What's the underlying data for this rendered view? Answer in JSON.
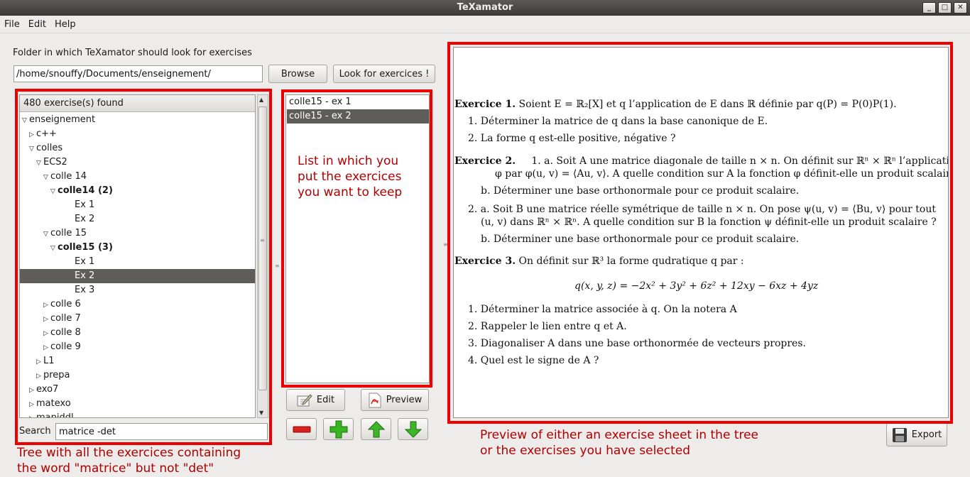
{
  "window": {
    "title": "TeXamator",
    "minimize_glyph": "_",
    "maximize_glyph": "□",
    "close_glyph": "✕"
  },
  "menu": [
    "File",
    "Edit",
    "Help"
  ],
  "folder": {
    "label": "Folder in which TeXamator should look for exercises",
    "path": "/home/snouffy/Documents/enseignement/",
    "browse_label": "Browse",
    "look_label": "Look for exercices !"
  },
  "tree": {
    "header": "480 exercise(s) found",
    "rows": [
      {
        "label": "enseignement",
        "arrow": "▽",
        "depth": 0,
        "bold": false,
        "selected": false
      },
      {
        "label": "c++",
        "arrow": "▷",
        "depth": 1,
        "bold": false,
        "selected": false
      },
      {
        "label": "colles",
        "arrow": "▽",
        "depth": 1,
        "bold": false,
        "selected": false
      },
      {
        "label": "ECS2",
        "arrow": "▽",
        "depth": 2,
        "bold": false,
        "selected": false
      },
      {
        "label": "colle 14",
        "arrow": "▽",
        "depth": 3,
        "bold": false,
        "selected": false
      },
      {
        "label": "colle14 (2)",
        "arrow": "▽",
        "depth": 4,
        "bold": true,
        "selected": false
      },
      {
        "label": "Ex 1",
        "arrow": "",
        "depth": 5,
        "bold": false,
        "selected": false
      },
      {
        "label": "Ex 2",
        "arrow": "",
        "depth": 5,
        "bold": false,
        "selected": false
      },
      {
        "label": "colle 15",
        "arrow": "▽",
        "depth": 3,
        "bold": false,
        "selected": false
      },
      {
        "label": "colle15 (3)",
        "arrow": "▽",
        "depth": 4,
        "bold": true,
        "selected": false
      },
      {
        "label": "Ex 1",
        "arrow": "",
        "depth": 5,
        "bold": false,
        "selected": false
      },
      {
        "label": "Ex 2",
        "arrow": "",
        "depth": 5,
        "bold": false,
        "selected": true
      },
      {
        "label": "Ex 3",
        "arrow": "",
        "depth": 5,
        "bold": false,
        "selected": false
      },
      {
        "label": "colle 6",
        "arrow": "▷",
        "depth": 3,
        "bold": false,
        "selected": false
      },
      {
        "label": "colle 7",
        "arrow": "▷",
        "depth": 3,
        "bold": false,
        "selected": false
      },
      {
        "label": "colle 8",
        "arrow": "▷",
        "depth": 3,
        "bold": false,
        "selected": false
      },
      {
        "label": "colle 9",
        "arrow": "▷",
        "depth": 3,
        "bold": false,
        "selected": false
      },
      {
        "label": "L1",
        "arrow": "▷",
        "depth": 2,
        "bold": false,
        "selected": false
      },
      {
        "label": "prepa",
        "arrow": "▷",
        "depth": 2,
        "bold": false,
        "selected": false
      },
      {
        "label": "exo7",
        "arrow": "▷",
        "depth": 1,
        "bold": false,
        "selected": false
      },
      {
        "label": "matexo",
        "arrow": "▷",
        "depth": 1,
        "bold": false,
        "selected": false
      },
      {
        "label": "mapiddl",
        "arrow": "▷",
        "depth": 1,
        "bold": false,
        "selected": false
      }
    ],
    "scroll_up": "▲",
    "scroll_down": "▼",
    "grip": "≡"
  },
  "search": {
    "label": "Search",
    "value": "matrice -det"
  },
  "selected_list": {
    "rows": [
      {
        "label": "colle15 - ex 1",
        "selected": false
      },
      {
        "label": "colle15 - ex 2",
        "selected": true
      }
    ]
  },
  "notes": {
    "list": [
      "List in which you",
      "put the exercices",
      "you want to keep"
    ],
    "tree": [
      "Tree with all the exercices containing",
      "the word \"matrice\" but not \"det\""
    ],
    "preview": [
      "Preview of either an exercise sheet in the tree",
      "or the exercises you have selected"
    ]
  },
  "buttons": {
    "edit": "Edit",
    "preview": "Preview",
    "export": "Export",
    "minus_icon": "minus-icon",
    "plus_icon": "plus-icon",
    "up_icon": "arrow-up-icon",
    "down_icon": "arrow-down-icon"
  },
  "preview": {
    "ex1_title": "Exercice 1.",
    "ex1_intro": "Soient E = ℝ₂[X] et q l’application de E dans ℝ définie par q(P) = P(0)P(1).",
    "ex1_items": [
      "1. Déterminer la matrice de q dans la base canonique de E.",
      "2. La forme q est-elle positive, négative ?"
    ],
    "ex2_title": "Exercice 2.",
    "ex2_line1": "1. a. Soit A une matrice diagonale de taille n × n. On définit sur ℝⁿ × ℝⁿ l’application",
    "ex2_line2": "φ par φ(u, v) = ⟨Au, v⟩. A quelle condition sur A la fonction φ définit-elle un produit scalaire ?",
    "ex2_line3": "b. Déterminer une base orthonormale pour ce produit scalaire.",
    "ex2_line4": "2. a. Soit B une matrice réelle symétrique de taille n × n. On pose ψ(u, v) = ⟨Bu, v⟩ pour tout",
    "ex2_line5": "(u, v) dans ℝⁿ × ℝⁿ. A quelle condition sur B la fonction ψ définit-elle un produit scalaire ?",
    "ex2_line6": "b. Déterminer une base orthonormale pour ce produit scalaire.",
    "ex3_title": "Exercice 3.",
    "ex3_intro": "On définit sur ℝ³ la forme qudratique q par :",
    "ex3_formula": "q(x, y, z) = −2x² + 3y² + 6z² + 12xy − 6xz + 4yz",
    "ex3_items": [
      "1. Déterminer la matrice associée à q. On la notera A",
      "2. Rappeler le lien entre q et A.",
      "3. Diagonaliser A dans une base orthonormée de vecteurs propres.",
      "4. Quel est le signe de A ?"
    ]
  }
}
